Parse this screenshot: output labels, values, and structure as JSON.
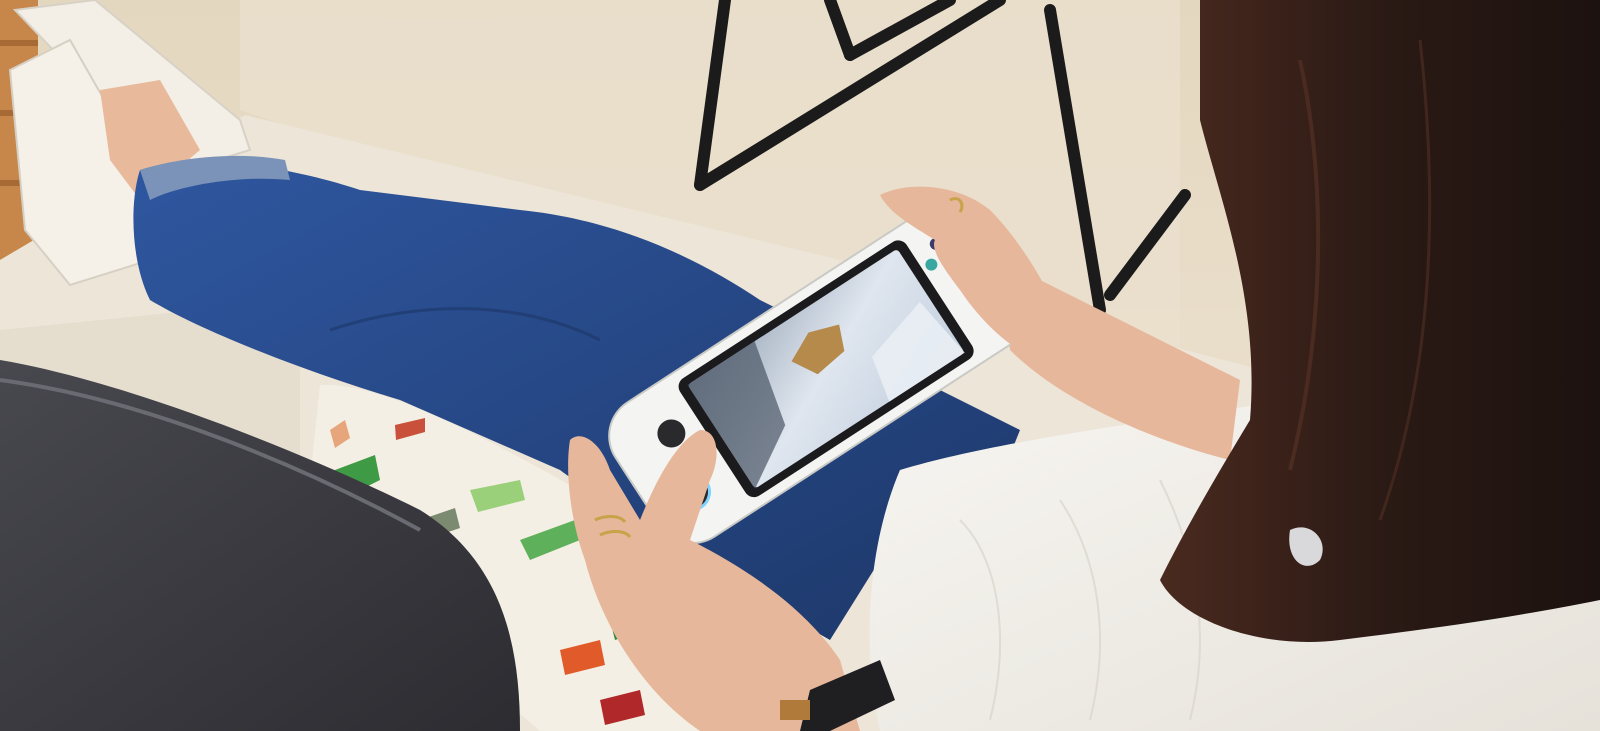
{
  "photo": {
    "subject": "",
    "device": {
      "screen_game": "",
      "side_text": "",
      "button_colors": [
        "#3b3b6a",
        "#e24a6a",
        "#3aa7a0",
        "#4a7bd0"
      ],
      "accent_ring_color": "#7fd3ff"
    },
    "colors": {
      "floor": "#e9dfcc",
      "sofa_cushion": "#ece6da",
      "jeans": "#2a4a86",
      "pillow_dark": "#3b3b40",
      "sweater": "#f3f1ec",
      "hair": "#2a1a15",
      "skin": "#e6b79a",
      "device_body": "#f4f4f2",
      "screen": "#dfe5ee"
    }
  }
}
